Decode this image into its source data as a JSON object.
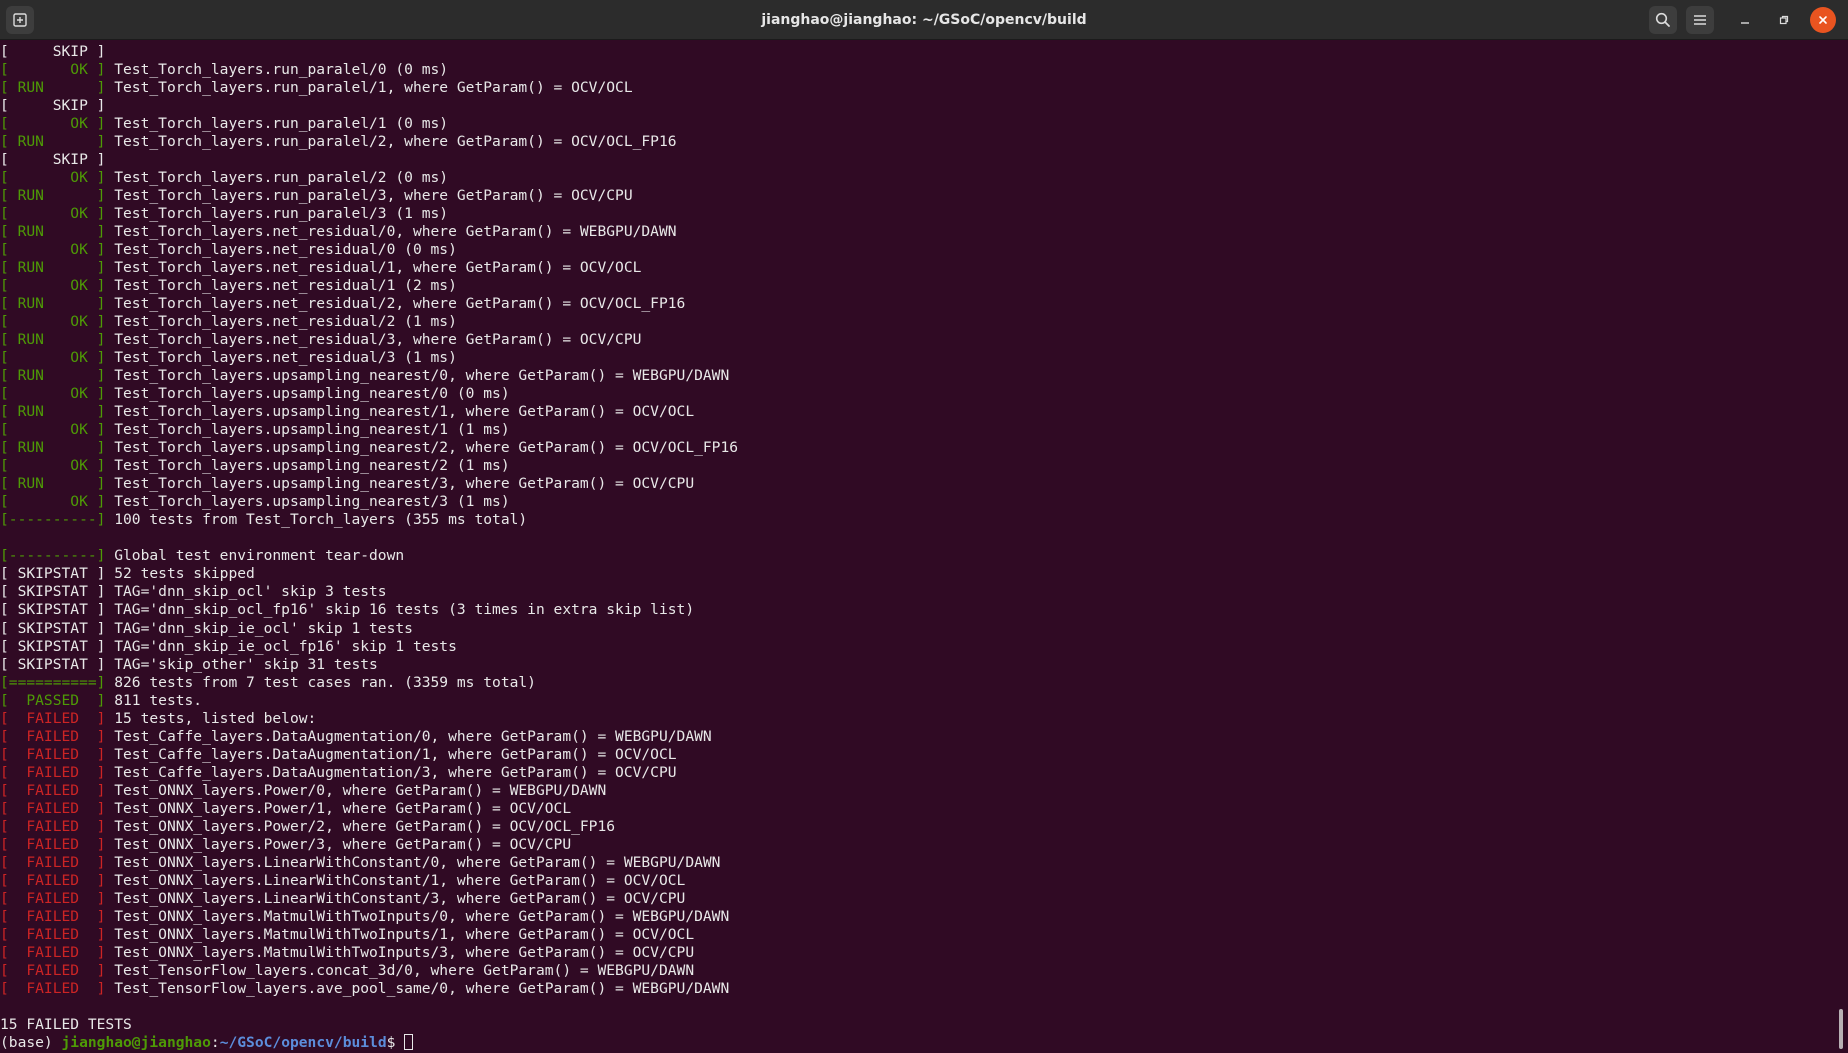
{
  "window": {
    "title": "jianghao@jianghao: ~/GSoC/opencv/build"
  },
  "icons": {
    "new_tab": "new-tab-icon",
    "search": "search-icon",
    "menu": "hamburger-menu-icon",
    "minimize": "minimize-icon",
    "maximize": "maximize-icon",
    "close": "close-icon"
  },
  "colors": {
    "background": "#300a24",
    "ok_green": "#4e9a06",
    "failed_red": "#cc2424",
    "path_blue": "#5c8ddb",
    "close_orange": "#e95420"
  },
  "terminal": {
    "lines": [
      {
        "tag": "[     SKIP ]",
        "c": "w",
        "text": ""
      },
      {
        "tag": "[       OK ]",
        "c": "g",
        "text": " Test_Torch_layers.run_paralel/0 (0 ms)"
      },
      {
        "tag": "[ RUN      ]",
        "c": "g",
        "text": " Test_Torch_layers.run_paralel/1, where GetParam() = OCV/OCL"
      },
      {
        "tag": "[     SKIP ]",
        "c": "w",
        "text": ""
      },
      {
        "tag": "[       OK ]",
        "c": "g",
        "text": " Test_Torch_layers.run_paralel/1 (0 ms)"
      },
      {
        "tag": "[ RUN      ]",
        "c": "g",
        "text": " Test_Torch_layers.run_paralel/2, where GetParam() = OCV/OCL_FP16"
      },
      {
        "tag": "[     SKIP ]",
        "c": "w",
        "text": ""
      },
      {
        "tag": "[       OK ]",
        "c": "g",
        "text": " Test_Torch_layers.run_paralel/2 (0 ms)"
      },
      {
        "tag": "[ RUN      ]",
        "c": "g",
        "text": " Test_Torch_layers.run_paralel/3, where GetParam() = OCV/CPU"
      },
      {
        "tag": "[       OK ]",
        "c": "g",
        "text": " Test_Torch_layers.run_paralel/3 (1 ms)"
      },
      {
        "tag": "[ RUN      ]",
        "c": "g",
        "text": " Test_Torch_layers.net_residual/0, where GetParam() = WEBGPU/DAWN"
      },
      {
        "tag": "[       OK ]",
        "c": "g",
        "text": " Test_Torch_layers.net_residual/0 (0 ms)"
      },
      {
        "tag": "[ RUN      ]",
        "c": "g",
        "text": " Test_Torch_layers.net_residual/1, where GetParam() = OCV/OCL"
      },
      {
        "tag": "[       OK ]",
        "c": "g",
        "text": " Test_Torch_layers.net_residual/1 (2 ms)"
      },
      {
        "tag": "[ RUN      ]",
        "c": "g",
        "text": " Test_Torch_layers.net_residual/2, where GetParam() = OCV/OCL_FP16"
      },
      {
        "tag": "[       OK ]",
        "c": "g",
        "text": " Test_Torch_layers.net_residual/2 (1 ms)"
      },
      {
        "tag": "[ RUN      ]",
        "c": "g",
        "text": " Test_Torch_layers.net_residual/3, where GetParam() = OCV/CPU"
      },
      {
        "tag": "[       OK ]",
        "c": "g",
        "text": " Test_Torch_layers.net_residual/3 (1 ms)"
      },
      {
        "tag": "[ RUN      ]",
        "c": "g",
        "text": " Test_Torch_layers.upsampling_nearest/0, where GetParam() = WEBGPU/DAWN"
      },
      {
        "tag": "[       OK ]",
        "c": "g",
        "text": " Test_Torch_layers.upsampling_nearest/0 (0 ms)"
      },
      {
        "tag": "[ RUN      ]",
        "c": "g",
        "text": " Test_Torch_layers.upsampling_nearest/1, where GetParam() = OCV/OCL"
      },
      {
        "tag": "[       OK ]",
        "c": "g",
        "text": " Test_Torch_layers.upsampling_nearest/1 (1 ms)"
      },
      {
        "tag": "[ RUN      ]",
        "c": "g",
        "text": " Test_Torch_layers.upsampling_nearest/2, where GetParam() = OCV/OCL_FP16"
      },
      {
        "tag": "[       OK ]",
        "c": "g",
        "text": " Test_Torch_layers.upsampling_nearest/2 (1 ms)"
      },
      {
        "tag": "[ RUN      ]",
        "c": "g",
        "text": " Test_Torch_layers.upsampling_nearest/3, where GetParam() = OCV/CPU"
      },
      {
        "tag": "[       OK ]",
        "c": "g",
        "text": " Test_Torch_layers.upsampling_nearest/3 (1 ms)"
      },
      {
        "tag": "[----------]",
        "c": "g",
        "text": " 100 tests from Test_Torch_layers (355 ms total)"
      },
      {
        "tag": "",
        "c": "w",
        "text": ""
      },
      {
        "tag": "[----------]",
        "c": "g",
        "text": " Global test environment tear-down"
      },
      {
        "tag": "[ SKIPSTAT ]",
        "c": "w",
        "text": " 52 tests skipped"
      },
      {
        "tag": "[ SKIPSTAT ]",
        "c": "w",
        "text": " TAG='dnn_skip_ocl' skip 3 tests"
      },
      {
        "tag": "[ SKIPSTAT ]",
        "c": "w",
        "text": " TAG='dnn_skip_ocl_fp16' skip 16 tests (3 times in extra skip list)"
      },
      {
        "tag": "[ SKIPSTAT ]",
        "c": "w",
        "text": " TAG='dnn_skip_ie_ocl' skip 1 tests"
      },
      {
        "tag": "[ SKIPSTAT ]",
        "c": "w",
        "text": " TAG='dnn_skip_ie_ocl_fp16' skip 1 tests"
      },
      {
        "tag": "[ SKIPSTAT ]",
        "c": "w",
        "text": " TAG='skip_other' skip 31 tests"
      },
      {
        "tag": "[==========]",
        "c": "g",
        "text": " 826 tests from 7 test cases ran. (3359 ms total)"
      },
      {
        "tag": "[  PASSED  ]",
        "c": "g",
        "text": " 811 tests."
      },
      {
        "tag": "[  FAILED  ]",
        "c": "r",
        "text": " 15 tests, listed below:"
      },
      {
        "tag": "[  FAILED  ]",
        "c": "r",
        "text": " Test_Caffe_layers.DataAugmentation/0, where GetParam() = WEBGPU/DAWN"
      },
      {
        "tag": "[  FAILED  ]",
        "c": "r",
        "text": " Test_Caffe_layers.DataAugmentation/1, where GetParam() = OCV/OCL"
      },
      {
        "tag": "[  FAILED  ]",
        "c": "r",
        "text": " Test_Caffe_layers.DataAugmentation/3, where GetParam() = OCV/CPU"
      },
      {
        "tag": "[  FAILED  ]",
        "c": "r",
        "text": " Test_ONNX_layers.Power/0, where GetParam() = WEBGPU/DAWN"
      },
      {
        "tag": "[  FAILED  ]",
        "c": "r",
        "text": " Test_ONNX_layers.Power/1, where GetParam() = OCV/OCL"
      },
      {
        "tag": "[  FAILED  ]",
        "c": "r",
        "text": " Test_ONNX_layers.Power/2, where GetParam() = OCV/OCL_FP16"
      },
      {
        "tag": "[  FAILED  ]",
        "c": "r",
        "text": " Test_ONNX_layers.Power/3, where GetParam() = OCV/CPU"
      },
      {
        "tag": "[  FAILED  ]",
        "c": "r",
        "text": " Test_ONNX_layers.LinearWithConstant/0, where GetParam() = WEBGPU/DAWN"
      },
      {
        "tag": "[  FAILED  ]",
        "c": "r",
        "text": " Test_ONNX_layers.LinearWithConstant/1, where GetParam() = OCV/OCL"
      },
      {
        "tag": "[  FAILED  ]",
        "c": "r",
        "text": " Test_ONNX_layers.LinearWithConstant/3, where GetParam() = OCV/CPU"
      },
      {
        "tag": "[  FAILED  ]",
        "c": "r",
        "text": " Test_ONNX_layers.MatmulWithTwoInputs/0, where GetParam() = WEBGPU/DAWN"
      },
      {
        "tag": "[  FAILED  ]",
        "c": "r",
        "text": " Test_ONNX_layers.MatmulWithTwoInputs/1, where GetParam() = OCV/OCL"
      },
      {
        "tag": "[  FAILED  ]",
        "c": "r",
        "text": " Test_ONNX_layers.MatmulWithTwoInputs/3, where GetParam() = OCV/CPU"
      },
      {
        "tag": "[  FAILED  ]",
        "c": "r",
        "text": " Test_TensorFlow_layers.concat_3d/0, where GetParam() = WEBGPU/DAWN"
      },
      {
        "tag": "[  FAILED  ]",
        "c": "r",
        "text": " Test_TensorFlow_layers.ave_pool_same/0, where GetParam() = WEBGPU/DAWN"
      },
      {
        "tag": "",
        "c": "w",
        "text": ""
      },
      {
        "tag": "",
        "c": "w",
        "text": "15 FAILED TESTS"
      }
    ],
    "prompt": {
      "env": "(base) ",
      "user_host": "jianghao@jianghao",
      "sep": ":",
      "path": "~/GSoC/opencv/build",
      "symbol": "$ "
    }
  }
}
